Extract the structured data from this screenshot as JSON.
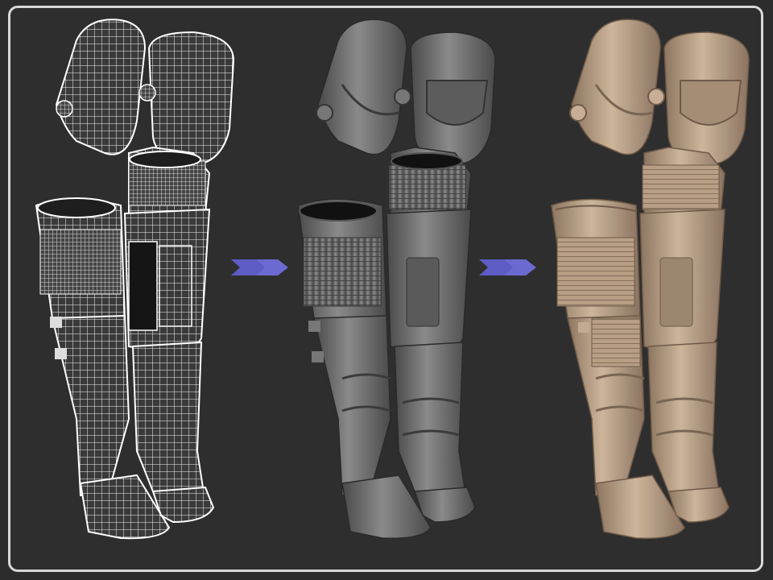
{
  "figure": {
    "stages": [
      {
        "id": "wireframe",
        "fill": "#d9d9d9",
        "wire": "#ffffff",
        "base": "#3a3a3a"
      },
      {
        "id": "grey-sculpt",
        "fill": "#6f6f6f",
        "light": "#8e8e8e",
        "dark": "#3e3e3e"
      },
      {
        "id": "clay-sculpt",
        "fill": "#b79e84",
        "light": "#d3bca3",
        "dark": "#7d6753"
      }
    ],
    "arrow_color": "#5d5cc4",
    "frame_color": "#d8d8d8",
    "background": "#2e2e2e"
  }
}
